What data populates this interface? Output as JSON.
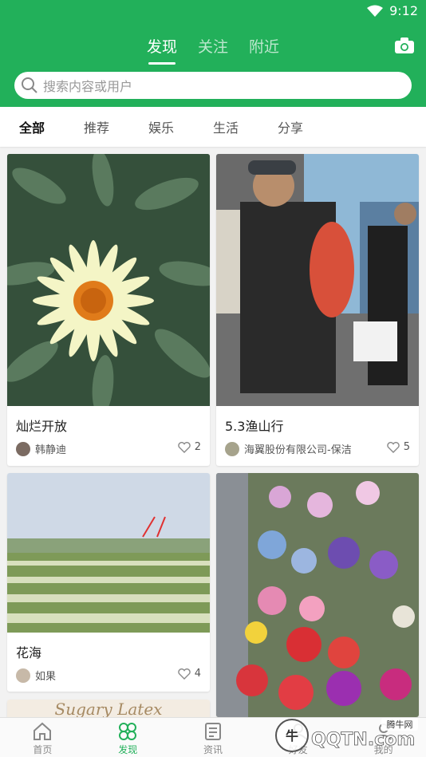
{
  "status": {
    "time": "9:12"
  },
  "top_tabs": [
    {
      "label": "发现",
      "active": true
    },
    {
      "label": "关注",
      "active": false
    },
    {
      "label": "附近",
      "active": false
    }
  ],
  "search": {
    "placeholder": "搜索内容或用户"
  },
  "categories": [
    {
      "label": "全部",
      "active": true
    },
    {
      "label": "推荐",
      "active": false
    },
    {
      "label": "娱乐",
      "active": false
    },
    {
      "label": "生活",
      "active": false
    },
    {
      "label": "分享",
      "active": false
    }
  ],
  "posts": [
    {
      "title": "灿烂开放",
      "author": "韩静迪",
      "likes": "2",
      "image": "white-daisy-flower"
    },
    {
      "title": "5.3渔山行",
      "author": "海翼股份有限公司-保洁",
      "likes": "5",
      "image": "man-holding-red-fish"
    },
    {
      "title": "花海",
      "author": "如果",
      "likes": "4",
      "image": "flower-field"
    },
    {
      "title": "",
      "author": "",
      "likes": "",
      "image": "potted-flower-market"
    }
  ],
  "partial_card_text": "Sugary Latex",
  "bottom_nav": [
    {
      "label": "首页",
      "icon": "home-icon",
      "active": false
    },
    {
      "label": "发现",
      "icon": "clover-icon",
      "active": true
    },
    {
      "label": "资讯",
      "icon": "news-icon",
      "active": false
    },
    {
      "label": "好友",
      "icon": "friends-icon",
      "active": false
    },
    {
      "label": "我的",
      "icon": "profile-icon",
      "active": false
    }
  ],
  "watermark": {
    "text": "QQTN.com",
    "badge": "腾牛网"
  },
  "colors": {
    "brand": "#22b05a"
  }
}
